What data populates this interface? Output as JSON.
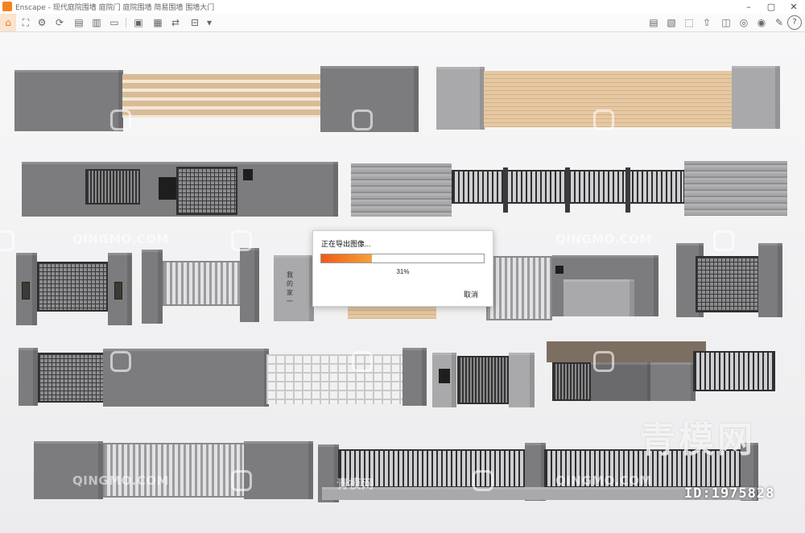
{
  "titlebar": {
    "app_name": "Enscape",
    "title": "Enscape - 现代庭院围墙 庭院门 庭院围墙 简易围墙 围墙大门",
    "minimize": "–",
    "maximize": "▢",
    "close": "✕"
  },
  "toolbar": {
    "home_icon": "home-icon",
    "help_label": "?"
  },
  "dialog": {
    "title": "正在导出图像...",
    "progress": 0.31,
    "percent_label": "31%",
    "cancel_label": "取消"
  },
  "watermarks": {
    "brand": "QINGMO.COM",
    "brand_cn": "青模网",
    "big": "青模网",
    "id": "ID:1975828"
  },
  "scene": {
    "sign_text": "我的家一"
  },
  "colors": {
    "accent": "#f58220",
    "progress_start": "#ef5a14",
    "progress_end": "#f6a23a"
  }
}
